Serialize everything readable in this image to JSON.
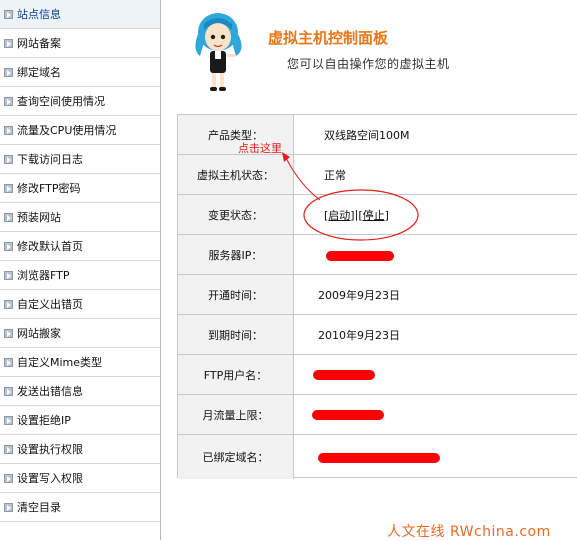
{
  "sidebar": {
    "items": [
      {
        "label": "站点信息"
      },
      {
        "label": "网站备案"
      },
      {
        "label": "绑定域名"
      },
      {
        "label": "查询空间使用情况"
      },
      {
        "label": "流量及CPU使用情况"
      },
      {
        "label": "下载访问日志"
      },
      {
        "label": "修改FTP密码"
      },
      {
        "label": "预装网站"
      },
      {
        "label": "修改默认首页"
      },
      {
        "label": "浏览器FTP"
      },
      {
        "label": "自定义出错页"
      },
      {
        "label": "网站搬家"
      },
      {
        "label": "自定义Mime类型"
      },
      {
        "label": "发送出错信息"
      },
      {
        "label": "设置拒绝IP"
      },
      {
        "label": "设置执行权限"
      },
      {
        "label": "设置写入权限"
      },
      {
        "label": "清空目录"
      }
    ]
  },
  "header": {
    "title": "虚拟主机控制面板",
    "subtitle": "您可以自由操作您的虚拟主机"
  },
  "info": {
    "product_type": {
      "key": "产品类型：",
      "value": "双线路空间100M"
    },
    "host_status": {
      "key": "虚拟主机状态：",
      "value": "正常"
    },
    "change_status": {
      "key": "变更状态：",
      "start": "[启动]",
      "stop": "[停止]",
      "sep": "|"
    },
    "server_ip": {
      "key": "服务器IP："
    },
    "open_time": {
      "key": "开通时间：",
      "value": "2009年9月23日"
    },
    "expire_time": {
      "key": "到期时间：",
      "value": "2010年9月23日"
    },
    "ftp_user": {
      "key": "FTP用户名："
    },
    "traffic_limit": {
      "key": "月流量上限："
    },
    "bound_domain": {
      "key": "已绑定域名："
    }
  },
  "annotation": {
    "click_here": "点击这里",
    "color": "#e0201a"
  },
  "watermark": "人文在线 RWchina.com",
  "colors": {
    "accent": "#e4781b",
    "redaction": "#ff0000"
  }
}
